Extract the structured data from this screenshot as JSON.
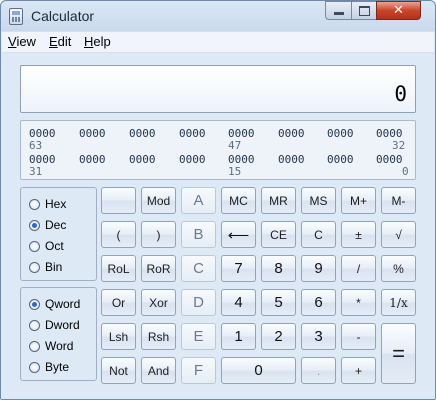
{
  "window": {
    "title": "Calculator"
  },
  "titlebar_buttons": {
    "close_glyph": "✕"
  },
  "menu": {
    "items": [
      {
        "label": "iew",
        "accel": "V"
      },
      {
        "label": "dit",
        "accel": "E"
      },
      {
        "label": "elp",
        "accel": "H"
      }
    ]
  },
  "display": {
    "value": "0"
  },
  "bits": {
    "row1": {
      "nibbles": [
        "0000",
        "0000",
        "0000",
        "0000",
        "0000",
        "0000",
        "0000",
        "0000"
      ],
      "labels": [
        "63",
        "47",
        "32"
      ]
    },
    "row2": {
      "nibbles": [
        "0000",
        "0000",
        "0000",
        "0000",
        "0000",
        "0000",
        "0000",
        "0000"
      ],
      "labels": [
        "31",
        "15",
        "0"
      ]
    }
  },
  "base_group": {
    "options": [
      "Hex",
      "Dec",
      "Oct",
      "Bin"
    ],
    "selected": "Dec"
  },
  "word_group": {
    "options": [
      "Qword",
      "Dword",
      "Word",
      "Byte"
    ],
    "selected": "Qword"
  },
  "keys": {
    "blank": "",
    "mod": "Mod",
    "a": "A",
    "mc": "MC",
    "mr": "MR",
    "ms": "MS",
    "mplus": "M+",
    "mminus": "M-",
    "lparen": "(",
    "rparen": ")",
    "b": "B",
    "backspace": "⟵",
    "ce": "CE",
    "c": "C",
    "plusminus": "±",
    "sqrt": "√",
    "rol": "RoL",
    "ror": "RoR",
    "c_hex": "C",
    "seven": "7",
    "eight": "8",
    "nine": "9",
    "divide": "/",
    "percent": "%",
    "or": "Or",
    "xor": "Xor",
    "d": "D",
    "four": "4",
    "five": "5",
    "six": "6",
    "multiply": "*",
    "reciprocal": "1/x",
    "lsh": "Lsh",
    "rsh": "Rsh",
    "e": "E",
    "one": "1",
    "two": "2",
    "three": "3",
    "minus": "-",
    "not": "Not",
    "and": "And",
    "f": "F",
    "zero": "0",
    "decimal": ".",
    "plus": "+",
    "equals": "="
  },
  "colors": {
    "accent": "#2f6bc2",
    "close_button": "#c8452b",
    "window_frame": "#c9d9ec"
  }
}
